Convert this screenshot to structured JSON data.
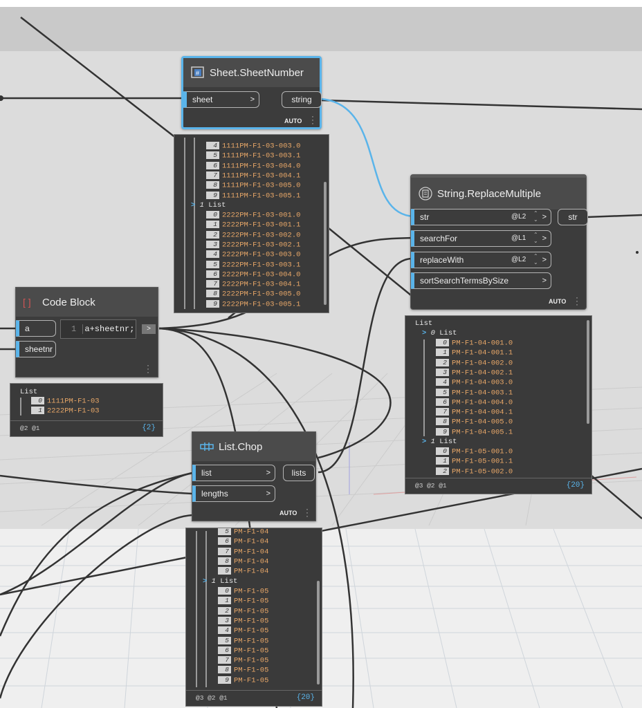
{
  "nodes": {
    "sheet_number": {
      "title": "Sheet.SheetNumber",
      "input": "sheet",
      "output": "string",
      "lacing": "AUTO"
    },
    "replace_multiple": {
      "title": "String.ReplaceMultiple",
      "inputs": [
        {
          "label": "str",
          "lacing": "@L2"
        },
        {
          "label": "searchFor",
          "lacing": "@L1"
        },
        {
          "label": "replaceWith",
          "lacing": "@L2"
        },
        {
          "label": "sortSearchTermsBySize",
          "lacing": ""
        }
      ],
      "output": "str",
      "lacing": "AUTO"
    },
    "code_block": {
      "title": "Code Block",
      "inputs": [
        "a",
        "sheetnr"
      ],
      "line_number": "1",
      "code": "a+sheetnr;",
      "output": ">"
    },
    "list_chop": {
      "title": "List.Chop",
      "inputs": [
        "list",
        "lengths"
      ],
      "output": "lists",
      "lacing": "AUTO"
    }
  },
  "previews": {
    "sheet_number": {
      "rows_top": [
        {
          "i": "4",
          "v": "1111PM-F1-03-003.0"
        },
        {
          "i": "5",
          "v": "1111PM-F1-03-003.1"
        },
        {
          "i": "6",
          "v": "1111PM-F1-03-004.0"
        },
        {
          "i": "7",
          "v": "1111PM-F1-03-004.1"
        },
        {
          "i": "8",
          "v": "1111PM-F1-03-005.0"
        },
        {
          "i": "9",
          "v": "1111PM-F1-03-005.1"
        }
      ],
      "sublist_index": "1",
      "sublist_label": "List",
      "rows_bottom": [
        {
          "i": "0",
          "v": "2222PM-F1-03-001.0"
        },
        {
          "i": "1",
          "v": "2222PM-F1-03-001.1"
        },
        {
          "i": "2",
          "v": "2222PM-F1-03-002.0"
        },
        {
          "i": "3",
          "v": "2222PM-F1-03-002.1"
        },
        {
          "i": "4",
          "v": "2222PM-F1-03-003.0"
        },
        {
          "i": "5",
          "v": "2222PM-F1-03-003.1"
        },
        {
          "i": "6",
          "v": "2222PM-F1-03-004.0"
        },
        {
          "i": "7",
          "v": "2222PM-F1-03-004.1"
        },
        {
          "i": "8",
          "v": "2222PM-F1-03-005.0"
        },
        {
          "i": "9",
          "v": "2222PM-F1-03-005.1"
        }
      ]
    },
    "code_block": {
      "header": "List",
      "rows": [
        {
          "i": "0",
          "v": "1111PM-F1-03"
        },
        {
          "i": "1",
          "v": "2222PM-F1-03"
        }
      ],
      "levels": "@2 @1",
      "count": "{2}"
    },
    "replace_multiple": {
      "header": "List",
      "sub0_index": "0",
      "sub0_label": "List",
      "rows0": [
        {
          "i": "0",
          "v": "PM-F1-04-001.0"
        },
        {
          "i": "1",
          "v": "PM-F1-04-001.1"
        },
        {
          "i": "2",
          "v": "PM-F1-04-002.0"
        },
        {
          "i": "3",
          "v": "PM-F1-04-002.1"
        },
        {
          "i": "4",
          "v": "PM-F1-04-003.0"
        },
        {
          "i": "5",
          "v": "PM-F1-04-003.1"
        },
        {
          "i": "6",
          "v": "PM-F1-04-004.0"
        },
        {
          "i": "7",
          "v": "PM-F1-04-004.1"
        },
        {
          "i": "8",
          "v": "PM-F1-04-005.0"
        },
        {
          "i": "9",
          "v": "PM-F1-04-005.1"
        }
      ],
      "sub1_index": "1",
      "sub1_label": "List",
      "rows1": [
        {
          "i": "0",
          "v": "PM-F1-05-001.0"
        },
        {
          "i": "1",
          "v": "PM-F1-05-001.1"
        },
        {
          "i": "2",
          "v": "PM-F1-05-002.0"
        }
      ],
      "levels": "@3 @2 @1",
      "count": "{20}"
    },
    "list_chop": {
      "rows_top": [
        {
          "i": "5",
          "v": "PM-F1-04"
        },
        {
          "i": "6",
          "v": "PM-F1-04"
        },
        {
          "i": "7",
          "v": "PM-F1-04"
        },
        {
          "i": "8",
          "v": "PM-F1-04"
        },
        {
          "i": "9",
          "v": "PM-F1-04"
        }
      ],
      "sublist_index": "1",
      "sublist_label": "List",
      "rows_bottom": [
        {
          "i": "0",
          "v": "PM-F1-05"
        },
        {
          "i": "1",
          "v": "PM-F1-05"
        },
        {
          "i": "2",
          "v": "PM-F1-05"
        },
        {
          "i": "3",
          "v": "PM-F1-05"
        },
        {
          "i": "4",
          "v": "PM-F1-05"
        },
        {
          "i": "5",
          "v": "PM-F1-05"
        },
        {
          "i": "6",
          "v": "PM-F1-05"
        },
        {
          "i": "7",
          "v": "PM-F1-05"
        },
        {
          "i": "8",
          "v": "PM-F1-05"
        },
        {
          "i": "9",
          "v": "PM-F1-05"
        }
      ],
      "levels": "@3 @2 @1",
      "count": "{20}"
    }
  },
  "colors": {
    "canvas": "#dcdcdc",
    "node_body": "#3c3c3c",
    "node_header": "#4b4b4b",
    "selection": "#5ab4ea",
    "value_text": "#e8a768",
    "wire": "#333333"
  }
}
